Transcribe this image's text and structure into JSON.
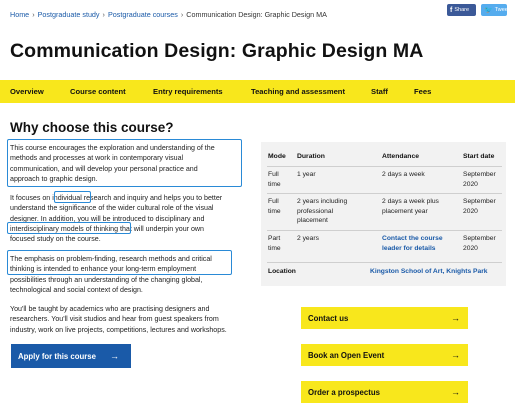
{
  "breadcrumb": {
    "items": [
      "Home",
      "Postgraduate study",
      "Postgraduate courses"
    ],
    "current": "Communication Design: Graphic Design MA",
    "separator": "›"
  },
  "share": {
    "facebook_label": "Share",
    "twitter_label": "Tweet",
    "facebook_icon": "f",
    "twitter_icon": "🐦"
  },
  "page_title": "Communication Design: Graphic Design MA",
  "nav": {
    "items": [
      "Overview",
      "Course content",
      "Entry requirements",
      "Teaching and assessment",
      "Staff",
      "Fees"
    ]
  },
  "why": {
    "title": "Why choose this course?",
    "paragraphs": [
      [
        "This course encourages the exploration and understanding of the",
        "methods and processes at work in contemporary visual",
        "communication, and will develop your personal practice and",
        "approach to graphic design."
      ],
      [
        "It focuses on individual research and inquiry and helps you to better",
        "understand the significance of the wider cultural role of the visual",
        "designer. In addition, you will be introduced to disciplinary and",
        "interdisciplinary models of thinking that will underpin your own",
        "focused study on the course."
      ],
      [
        "The emphasis on problem-finding, research methods and critical",
        "thinking is intended to enhance your long-term employment",
        "possibilities through an understanding of the changing global,",
        "technological and social context of design."
      ],
      [
        "You'll be taught by academics who are practising designers and",
        "researchers. You'll visit studios and hear from guest speakers from",
        "industry, work on live projects, competitions, lectures and workshops."
      ]
    ]
  },
  "apply_button": {
    "label": "Apply for this course",
    "arrow": "→"
  },
  "course_table": {
    "headers": [
      "Mode",
      "Duration",
      "Attendance",
      "Start date"
    ],
    "rows": [
      {
        "mode": [
          "Full",
          "time"
        ],
        "duration": [
          "1 year"
        ],
        "attendance": [
          "2 days a week"
        ],
        "start": [
          "September",
          "2020"
        ]
      },
      {
        "mode": [
          "Full",
          "time"
        ],
        "duration": [
          "2 years including",
          "professional",
          "placement"
        ],
        "attendance": [
          "2 days a week plus",
          "placement year"
        ],
        "start": [
          "September",
          "2020"
        ]
      },
      {
        "mode": [
          "Part",
          "time"
        ],
        "duration": [
          "2 years"
        ],
        "attendance": [
          "Contact the course",
          "leader for details"
        ],
        "start": [
          "September",
          "2020"
        ]
      }
    ],
    "location_label": "Location",
    "location_value": "Kingston School of Art, Knights Park"
  },
  "ctas": [
    {
      "label": "Contact us",
      "arrow": "→"
    },
    {
      "label": "Book an Open Event",
      "arrow": "→"
    },
    {
      "label": "Order a prospectus",
      "arrow": "→"
    }
  ],
  "colors": {
    "accent_yellow": "#f8e71c",
    "link_blue": "#1a5aa8",
    "highlight_box": "#2a8ad6"
  }
}
